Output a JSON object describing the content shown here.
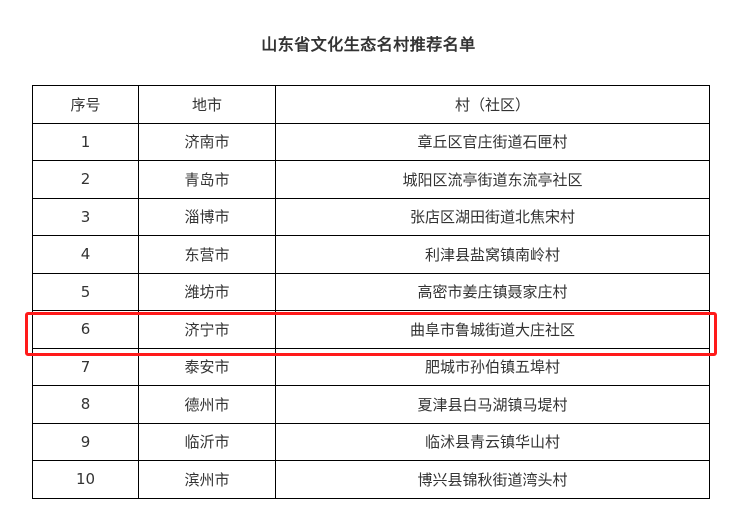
{
  "title": "山东省文化生态名村推荐名单",
  "table": {
    "headers": {
      "no": "序号",
      "city": "地市",
      "village": "村（社区）"
    },
    "rows": [
      {
        "no": "1",
        "city": "济南市",
        "village": "章丘区官庄街道石匣村"
      },
      {
        "no": "2",
        "city": "青岛市",
        "village": "城阳区流亭街道东流亭社区"
      },
      {
        "no": "3",
        "city": "淄博市",
        "village": "张店区湖田街道北焦宋村"
      },
      {
        "no": "4",
        "city": "东营市",
        "village": "利津县盐窝镇南岭村"
      },
      {
        "no": "5",
        "city": "潍坊市",
        "village": "高密市姜庄镇聂家庄村"
      },
      {
        "no": "6",
        "city": "济宁市",
        "village": "曲阜市鲁城街道大庄社区"
      },
      {
        "no": "7",
        "city": "泰安市",
        "village": "肥城市孙伯镇五埠村"
      },
      {
        "no": "8",
        "city": "德州市",
        "village": "夏津县白马湖镇马堤村"
      },
      {
        "no": "9",
        "city": "临沂市",
        "village": "临沭县青云镇华山村"
      },
      {
        "no": "10",
        "city": "滨州市",
        "village": "博兴县锦秋街道湾头村"
      }
    ],
    "highlighted_row": 6
  },
  "colors": {
    "highlight": "#ff1a1a",
    "border": "#000000",
    "text": "#333333"
  }
}
